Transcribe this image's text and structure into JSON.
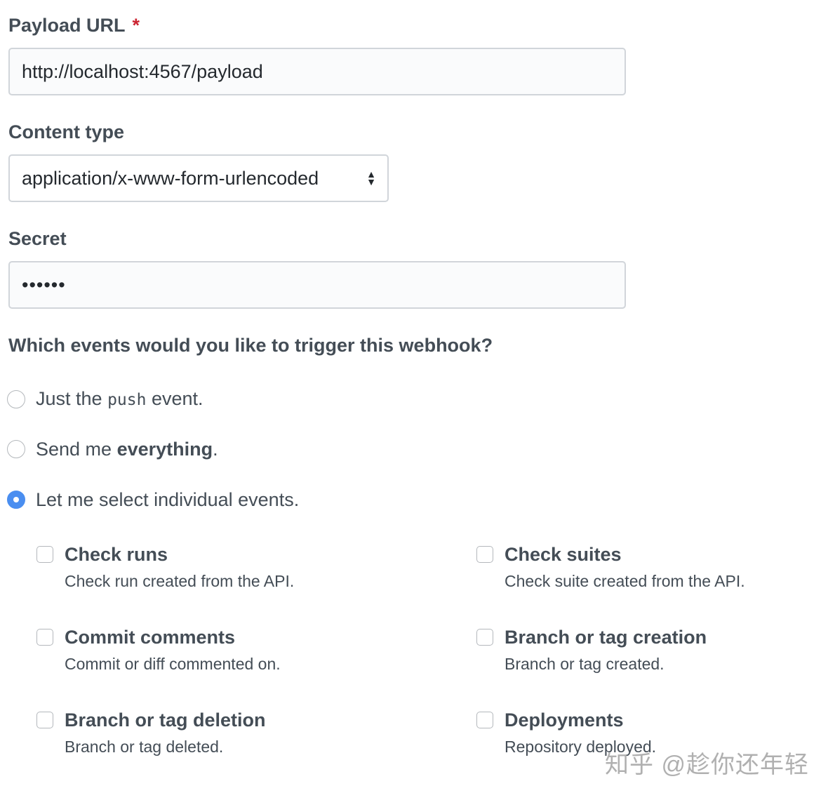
{
  "payload_url": {
    "label": "Payload URL",
    "required_mark": "*",
    "value": "http://localhost:4567/payload"
  },
  "content_type": {
    "label": "Content type",
    "selected": "application/x-www-form-urlencoded"
  },
  "secret": {
    "label": "Secret",
    "value": "••••••"
  },
  "events": {
    "question": "Which events would you like to trigger this webhook?",
    "options": [
      {
        "prefix": "Just the ",
        "code": "push",
        "suffix": " event.",
        "checked": false
      },
      {
        "prefix": "Send me ",
        "strong": "everything",
        "suffix": ".",
        "checked": false
      },
      {
        "prefix": "Let me select individual events.",
        "checked": true
      }
    ],
    "individual": [
      {
        "title": "Check runs",
        "desc": "Check run created from the API.",
        "checked": false
      },
      {
        "title": "Check suites",
        "desc": "Check suite created from the API.",
        "checked": false
      },
      {
        "title": "Commit comments",
        "desc": "Commit or diff commented on.",
        "checked": false
      },
      {
        "title": "Branch or tag creation",
        "desc": "Branch or tag created.",
        "checked": false
      },
      {
        "title": "Branch or tag deletion",
        "desc": "Branch or tag deleted.",
        "checked": false
      },
      {
        "title": "Deployments",
        "desc": "Repository deployed.",
        "checked": false
      }
    ]
  },
  "watermark": "知乎 @趁你还年轻",
  "colors": {
    "accent": "#4a8ef0",
    "required": "#cb2431",
    "text": "#444d56"
  }
}
